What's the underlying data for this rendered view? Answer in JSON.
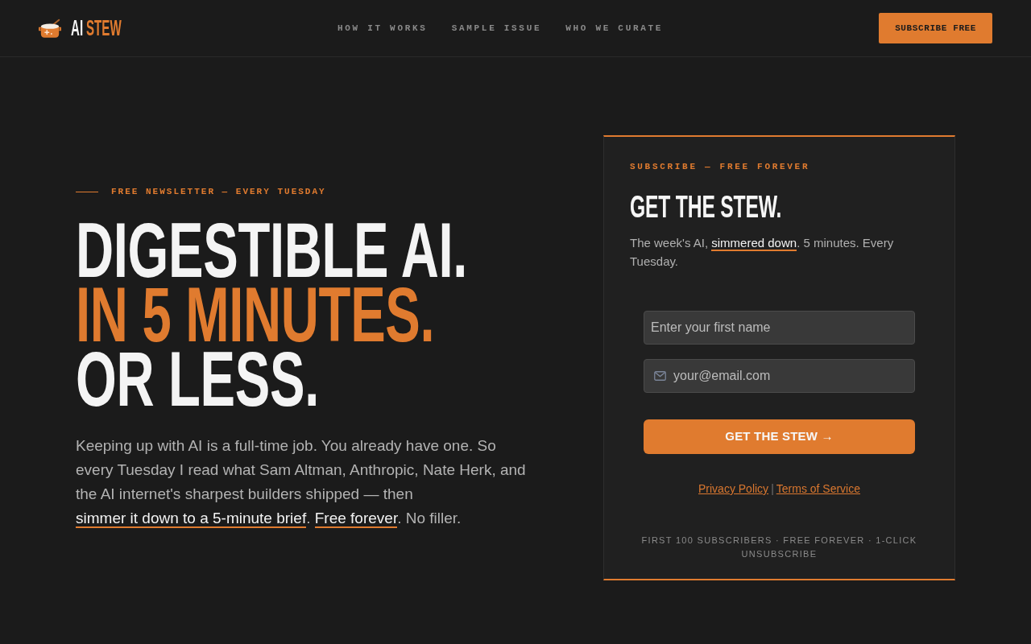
{
  "header": {
    "logo": [
      {
        "text": "AI",
        "accent": false
      },
      {
        "text": "STEW",
        "accent": true
      }
    ],
    "nav": [
      {
        "label": "HOW IT WORKS"
      },
      {
        "label": "SAMPLE ISSUE"
      },
      {
        "label": "WHO WE CURATE"
      }
    ],
    "cta_button": "SUBSCRIBE FREE"
  },
  "hero": {
    "eyebrow": "FREE NEWSLETTER — EVERY TUESDAY",
    "headline": [
      {
        "text": "DIGESTIBLE AI.",
        "accent": false
      },
      {
        "text": "IN 5 MINUTES.",
        "accent": true
      },
      {
        "text": "OR LESS.",
        "accent": false
      }
    ],
    "intro": [
      {
        "kind": "plain",
        "text": "Keeping up with AI is a full-time job. You already have one. So every Tuesday I read what Sam Altman, Anthropic, Nate Herk, and the AI internet's sharpest builders shipped — then "
      },
      {
        "kind": "link",
        "text": "simmer it down to a 5-minute brief"
      },
      {
        "kind": "plain",
        "text": ". "
      },
      {
        "kind": "link",
        "text": "Free forever"
      },
      {
        "kind": "plain",
        "text": ". No filler."
      }
    ]
  },
  "signup_card": {
    "eyebrow": "SUBSCRIBE — FREE FOREVER",
    "title": "GET THE STEW.",
    "description": [
      {
        "kind": "plain",
        "text": "The week's AI, "
      },
      {
        "kind": "link",
        "text": "simmered down"
      },
      {
        "kind": "plain",
        "text": ". 5 minutes. Every Tuesday."
      }
    ],
    "fields": [
      {
        "kind": "text",
        "placeholder": "Enter your first name"
      },
      {
        "kind": "email",
        "placeholder": "your@email.com"
      }
    ],
    "submit_button": "GET THE STEW →",
    "legal_links": [
      "Privacy Policy",
      "Terms of Service"
    ],
    "legal_separator": "|",
    "footnote": "FIRST 100 SUBSCRIBERS · FREE FOREVER · 1-CLICK UNSUBSCRIBE"
  }
}
